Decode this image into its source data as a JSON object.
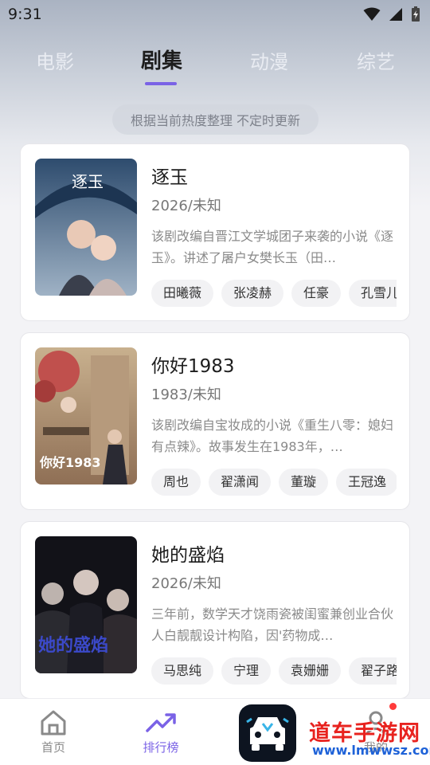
{
  "status_bar": {
    "time": "9:31"
  },
  "tabs": [
    {
      "label": "电影",
      "active": false
    },
    {
      "label": "剧集",
      "active": true
    },
    {
      "label": "动漫",
      "active": false
    },
    {
      "label": "综艺",
      "active": false
    }
  ],
  "subtitle": "根据当前热度整理 不定时更新",
  "cards": [
    {
      "title": "逐玉",
      "year": "2026/未知",
      "desc": "该剧改编自晋江文学城团子来袭的小说《逐玉》。讲述了屠户女樊长玉（田…",
      "tags": [
        "田曦薇",
        "张凌赫",
        "任豪",
        "孔雪儿"
      ],
      "poster_text": "逐玉"
    },
    {
      "title": "你好1983",
      "year": "1983/未知",
      "desc": "该剧改编自宝妆成的小说《重生八零：媳妇有点辣》。故事发生在1983年，…",
      "tags": [
        "周也",
        "翟潇闻",
        "董璇",
        "王冠逸"
      ],
      "poster_text": "你好1983"
    },
    {
      "title": "她的盛焰",
      "year": "2026/未知",
      "desc": "三年前，数学天才饶雨瓷被闺蜜兼创业合伙人白靓靓设计构陷，因'药物成…",
      "tags": [
        "马思纯",
        "宁理",
        "袁姗姗",
        "翟子路"
      ],
      "poster_text": "她的盛焰"
    }
  ],
  "bottom_nav": [
    {
      "label": "首页",
      "icon": "home-icon",
      "active": false
    },
    {
      "label": "排行榜",
      "icon": "trending-icon",
      "active": true
    },
    {
      "label": "我的",
      "icon": "user-icon",
      "active": false
    }
  ],
  "watermark": {
    "main": "道车手游网",
    "sub": "www.lmwwsz.com"
  },
  "colors": {
    "accent": "#7a62e6",
    "watermark_red": "#e8231f",
    "watermark_blue": "#1e62d8"
  }
}
